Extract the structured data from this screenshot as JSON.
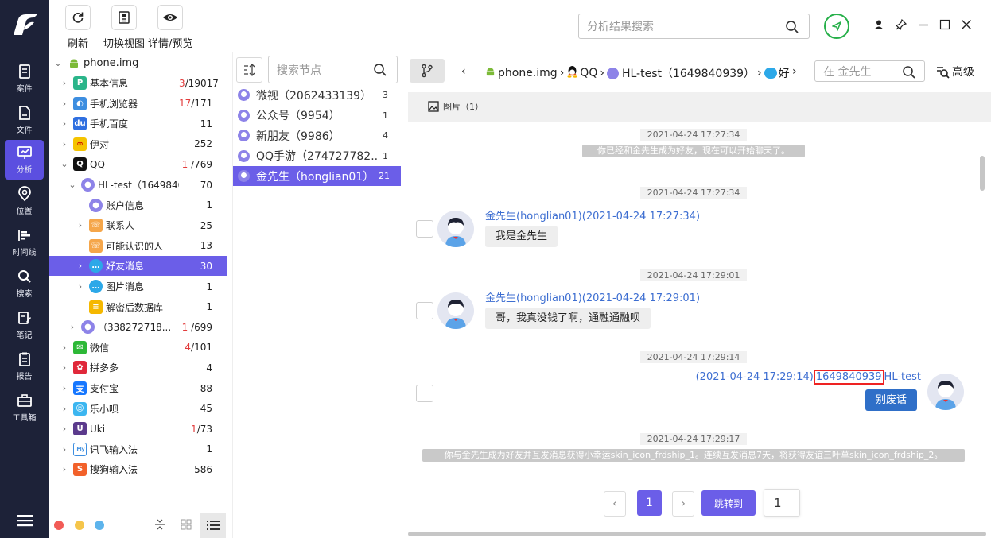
{
  "toolbar": {
    "refresh": "刷新",
    "switch_view": "切换视图",
    "details": "详情/预览"
  },
  "rail": {
    "items": [
      "案件",
      "文件",
      "分析",
      "位置",
      "时间线",
      "搜索",
      "笔记",
      "报告",
      "工具箱"
    ],
    "active": "分析"
  },
  "tree": {
    "root": "phone.img",
    "rows": [
      {
        "name": "基本信息",
        "count_red": "3",
        "count": "/19017"
      },
      {
        "name": "手机浏览器",
        "count_red": "17",
        "count": "/171"
      },
      {
        "name": "手机百度",
        "count_red": "",
        "count": "11"
      },
      {
        "name": "伊对",
        "count_red": "",
        "count": "252"
      },
      {
        "name": "QQ",
        "count_red": "1",
        "count": " /769"
      },
      {
        "name": "HL-test（16498409...",
        "count_red": "",
        "count": "70"
      },
      {
        "name": "账户信息",
        "count_red": "",
        "count": "1"
      },
      {
        "name": "联系人",
        "count_red": "",
        "count": "25"
      },
      {
        "name": "可能认识的人",
        "count_red": "",
        "count": "13"
      },
      {
        "name": "好友消息",
        "count_red": "",
        "count": "30"
      },
      {
        "name": "图片消息",
        "count_red": "",
        "count": "1"
      },
      {
        "name": "解密后数据库",
        "count_red": "",
        "count": "1"
      },
      {
        "name": "（338272718...",
        "count_red": "1",
        "count": " /699"
      },
      {
        "name": "微信",
        "count_red": "4",
        "count": "/101"
      },
      {
        "name": "拼多多",
        "count_red": "",
        "count": "4"
      },
      {
        "name": "支付宝",
        "count_red": "",
        "count": "88"
      },
      {
        "name": "乐小呗",
        "count_red": "",
        "count": "45"
      },
      {
        "name": "Uki",
        "count_red": "1",
        "count": "/73"
      },
      {
        "name": "讯飞输入法",
        "count_red": "",
        "count": "1"
      },
      {
        "name": "搜狗输入法",
        "count_red": "",
        "count": "586"
      }
    ]
  },
  "nodes": {
    "search_placeholder": "搜索节点",
    "items": [
      {
        "label": "微视（2062433139）",
        "count": "3"
      },
      {
        "label": "公众号（9954）",
        "count": "1"
      },
      {
        "label": "新朋友（9986）",
        "count": "4"
      },
      {
        "label": "QQ手游（274727782...",
        "count": "1"
      },
      {
        "label": "金先生（honglian01）",
        "count": "21"
      }
    ]
  },
  "header": {
    "search_placeholder": "分析结果搜索"
  },
  "breadcrumb": {
    "items": [
      "phone.img",
      "QQ",
      "HL-test（1649840939）",
      "好"
    ],
    "in_search_placeholder": "在 金先生",
    "advanced": "高级"
  },
  "subbar": {
    "tab": "图片（1）"
  },
  "chat": {
    "messages": [
      {
        "time": "2021-04-24 17:27:34",
        "system": "你已经和金先生成为好友，现在可以开始聊天了。"
      },
      {
        "time": "2021-04-24 17:27:34",
        "sender": "金先生(honglian01)(2021-04-24 17:27:34)",
        "text": "我是金先生"
      },
      {
        "time": "2021-04-24 17:29:01",
        "sender": "金先生(honglian01)(2021-04-24 17:29:01)",
        "text": "哥，我真没钱了啊，通融通融呗"
      },
      {
        "time": "2021-04-24 17:29:14",
        "sender_prefix": "(2021-04-24 17:29:14)",
        "sender_id": "1649840939",
        "sender_suffix": "HL-test",
        "text": "别废话"
      },
      {
        "time": "2021-04-24 17:29:17",
        "system": "你与金先生成为好友并互发消息获得小幸运skin_icon_frdship_1。连续互发消息7天，将获得友谊三叶草skin_icon_frdship_2。"
      }
    ]
  },
  "pager": {
    "current": "1",
    "jump_label": "跳转到",
    "jump_value": "1"
  },
  "colors": {
    "accent": "#6b5ee8",
    "rail": "#1d2238",
    "link": "#3d6ed1",
    "send_bubble": "#2f6fc8"
  }
}
